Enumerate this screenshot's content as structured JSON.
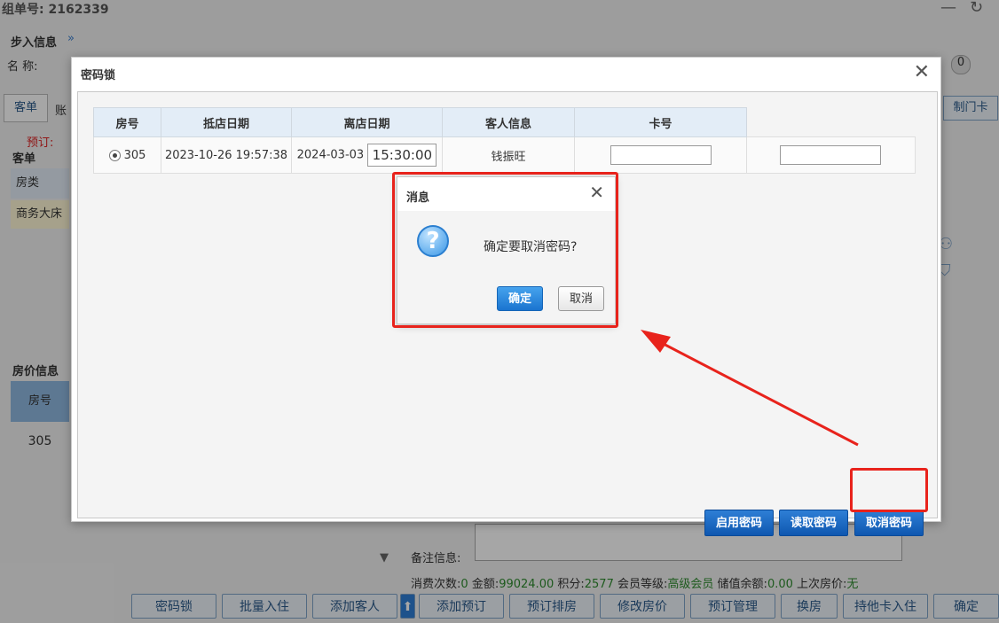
{
  "background": {
    "order_label": "组单号: 2162339",
    "section_checkin": "步入信息",
    "name_label": "名    称:",
    "tab_guest": "客单",
    "tab_account": "账",
    "reserve_label": "预订:",
    "guest_section": "客单",
    "room_type_header": "房类",
    "room_type_value": "商务大床",
    "price_section": "房价信息",
    "room_no_header": "房号",
    "room_no_value": "305",
    "make_card": "制门卡",
    "remark_label": "备注信息:",
    "summary": {
      "visits_label": "消费次数:",
      "visits": "0",
      "amount_label": "金额:",
      "amount": "99024.00",
      "points_label": "积分:",
      "points": "2577",
      "level_label": "会员等级:",
      "level": "高级会员",
      "balance_label": "储值余额:",
      "balance": "0.00",
      "last_price_label": "上次房价:",
      "last_price": "无"
    },
    "buttons": [
      "密码锁",
      "批量入住",
      "添加客人",
      "添加预订",
      "预订排房",
      "修改房价",
      "预订管理",
      "换房",
      "持他卡入住",
      "确定"
    ]
  },
  "dialog": {
    "title": "密码锁",
    "columns": [
      "房号",
      "抵店日期",
      "离店日期",
      "客人信息",
      "卡号"
    ],
    "row": {
      "room": "305",
      "arrival": "2023-10-26 19:57:38",
      "departure_date": "2024-03-03",
      "departure_time": "15:30:00",
      "guest": "钱振旺"
    },
    "buttons": {
      "enable": "启用密码",
      "read": "读取密码",
      "cancel": "取消密码"
    }
  },
  "message": {
    "title": "消息",
    "text": "确定要取消密码?",
    "ok": "确定",
    "cancel": "取消"
  },
  "colors": {
    "highlight": "#e8231c",
    "primary_button": "#0e57b0",
    "summary_value": "#2e8b2e"
  }
}
